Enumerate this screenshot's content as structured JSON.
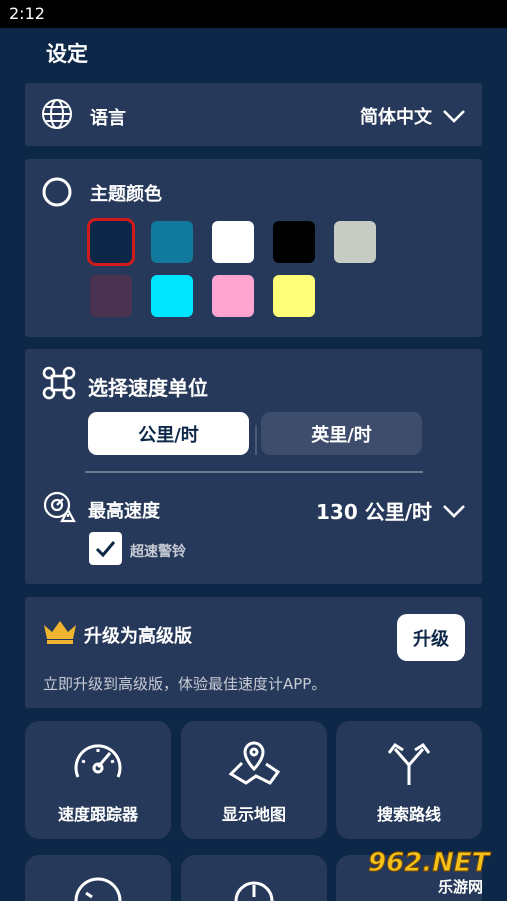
{
  "status": {
    "time": "2:12"
  },
  "page": {
    "title": "设定"
  },
  "language": {
    "label": "语言",
    "value": "简体中文"
  },
  "theme": {
    "label": "主题颜色",
    "colors": [
      "#0c2747",
      "#127a9c",
      "#ffffff",
      "#000000",
      "#c6ccc4",
      "#4a3250",
      "#00e5ff",
      "#ffa5d0",
      "#ffff78"
    ],
    "selected_index": 0
  },
  "speed_unit": {
    "label": "选择速度单位",
    "options": [
      "公里/时",
      "英里/时"
    ],
    "selected": "公里/时"
  },
  "max_speed": {
    "label": "最高速度",
    "value": "130 公里/时",
    "alarm_label": "超速警铃",
    "alarm_checked": true
  },
  "upgrade": {
    "title": "升级为高级版",
    "button": "升级",
    "description": "立即升级到高级版，体验最佳速度计APP。"
  },
  "tiles": [
    {
      "label": "速度跟踪器",
      "icon": "speedometer-icon"
    },
    {
      "label": "显示地图",
      "icon": "map-pin-icon"
    },
    {
      "label": "搜索路线",
      "icon": "route-split-icon"
    }
  ],
  "watermark": {
    "brand": "962.NET",
    "site": "乐游网"
  }
}
